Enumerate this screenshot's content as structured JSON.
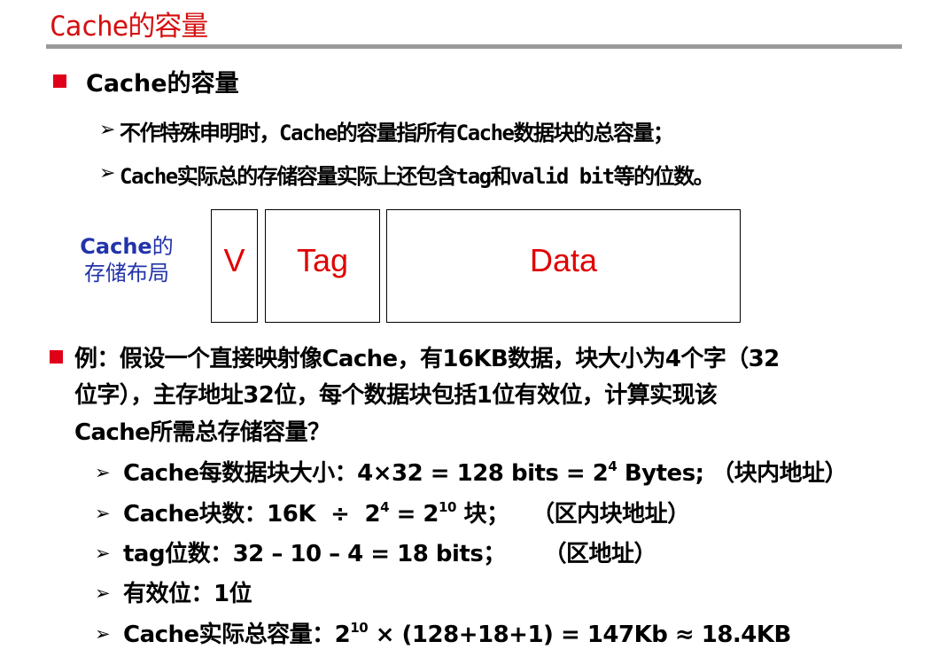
{
  "title": "Cache的容量",
  "bullet1": {
    "heading": "Cache的容量",
    "sub": [
      "不作特殊申明时，Cache的容量指所有Cache数据块的总容量；",
      "Cache实际总的存储容量实际上还包含tag和valid bit等的位数。"
    ]
  },
  "storage_layout": {
    "caption_en": "Cache",
    "caption_zh1": "的",
    "caption_zh2": "存储布局",
    "fields": [
      "V",
      "Tag",
      "Data"
    ],
    "field_color": "#e00000",
    "caption_color": "#2233aa"
  },
  "example": {
    "line1": "例：假设一个直接映射像Cache，有16KB数据，块大小为4个字（32",
    "line2": "位字），主存地址32位，每个数据块包括1位有效位，计算实现该",
    "line3": "Cache所需总存储容量？",
    "calc": {
      "block_size_pre": "Cache每数据块大小：4×32 = 128 bits = 2",
      "block_size_exp": "4",
      "block_size_post": " Bytes; （块内地址）",
      "blocks_pre": "Cache块数：16K  ÷  2",
      "blocks_exp1": "4",
      "blocks_mid": " = 2",
      "blocks_exp2": "10",
      "blocks_post": " 块；   （区内块地址）",
      "tag_bits": "tag位数：32 – 10 – 4 = 18 bits；     （区地址）",
      "valid_bit": "有效位：1位",
      "total_pre": "Cache实际总容量：2",
      "total_exp": "10",
      "total_post": " × (128+18+1) = 147Kb ≈ 18.4KB"
    }
  },
  "symbols": {
    "arrow": "➢"
  },
  "colors": {
    "title": "#d50f0f",
    "bullet": "#e0001a",
    "rule": "#9a9a9a"
  }
}
